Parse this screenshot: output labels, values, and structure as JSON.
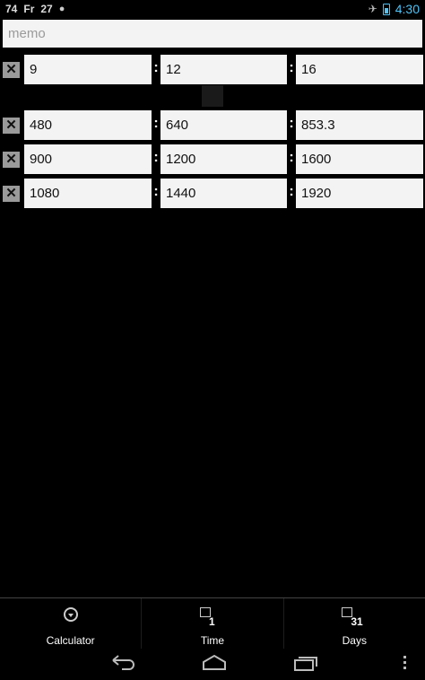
{
  "status_bar": {
    "left_items": [
      "74",
      "Fr",
      "27"
    ],
    "time": "4:30",
    "icons": [
      "android-icon",
      "airplane-icon",
      "battery-icon"
    ]
  },
  "memo": {
    "placeholder": "memo"
  },
  "ratio_rows": [
    {
      "a": "9",
      "b": "12",
      "c": "16"
    },
    {
      "a": "480",
      "b": "640",
      "c": "853.3"
    },
    {
      "a": "900",
      "b": "1200",
      "c": "1600"
    },
    {
      "a": "1080",
      "b": "1440",
      "c": "1920"
    }
  ],
  "separator": ":",
  "delete_glyph": "✕",
  "tabs": [
    {
      "label": "Calculator",
      "icon": "dropdown-circle-icon"
    },
    {
      "label": "Time",
      "icon": "calendar-icon",
      "badge": "1"
    },
    {
      "label": "Days",
      "icon": "calendar-icon",
      "badge": "31"
    }
  ],
  "navbar": {
    "buttons": [
      "back-icon",
      "home-icon",
      "recent-apps-icon",
      "overflow-menu-icon"
    ]
  },
  "colors": {
    "accent": "#4fc3f7",
    "field_bg": "#f3f3f3",
    "delete_bg": "#9a9a9a"
  }
}
